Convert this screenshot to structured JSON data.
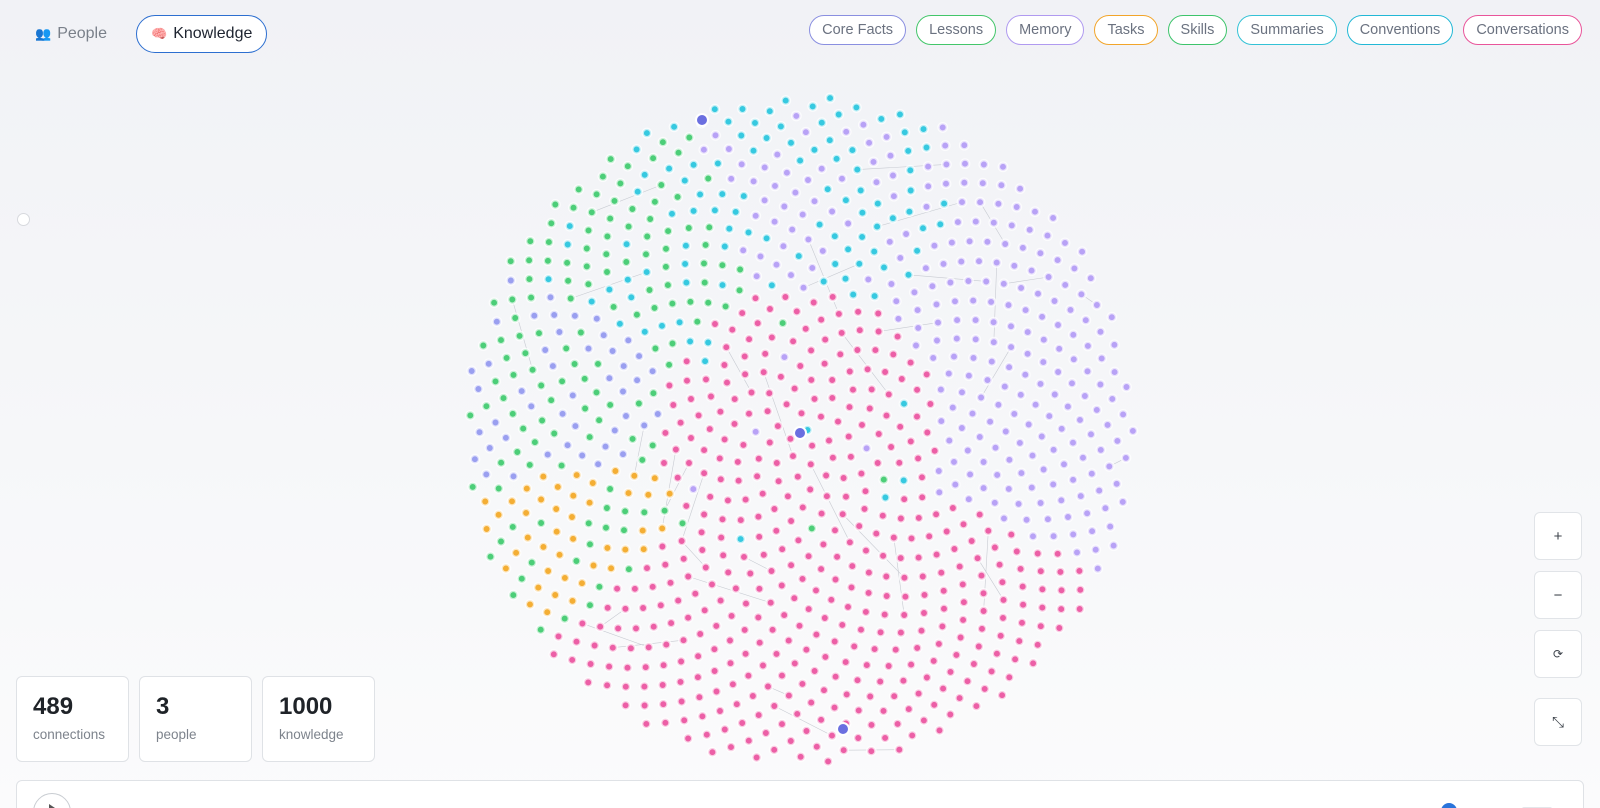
{
  "view_toggle": {
    "people": {
      "icon": "👥",
      "label": "People"
    },
    "knowledge": {
      "icon": "🧠",
      "label": "Knowledge"
    }
  },
  "filters": [
    {
      "label": "Core Facts",
      "color": "#8a8fe0"
    },
    {
      "label": "Lessons",
      "color": "#43c66a"
    },
    {
      "label": "Memory",
      "color": "#b09af0"
    },
    {
      "label": "Tasks",
      "color": "#f2a52a"
    },
    {
      "label": "Skills",
      "color": "#3dc46b"
    },
    {
      "label": "Summaries",
      "color": "#34c2d6"
    },
    {
      "label": "Conventions",
      "color": "#22b8d6"
    },
    {
      "label": "Conversations",
      "color": "#e9559a"
    }
  ],
  "stats": [
    {
      "value": "489",
      "label": "connections"
    },
    {
      "value": "3",
      "label": "people"
    },
    {
      "value": "1000",
      "label": "knowledge"
    }
  ],
  "controls": {
    "zoom_in": "+",
    "zoom_out": "−",
    "reset": "⟳",
    "fit": "⤡"
  },
  "graph": {
    "total_nodes": 1000,
    "person_nodes": 3,
    "colors": {
      "conversations": "#ec5fa6",
      "memory": "#b8a2f6",
      "core_facts": "#9a9ff0",
      "summaries": "#36c9e0",
      "lessons": "#4cce78",
      "tasks": "#f4ae34",
      "person": "#6b6fe0",
      "edge": "#c8cbd2"
    }
  }
}
